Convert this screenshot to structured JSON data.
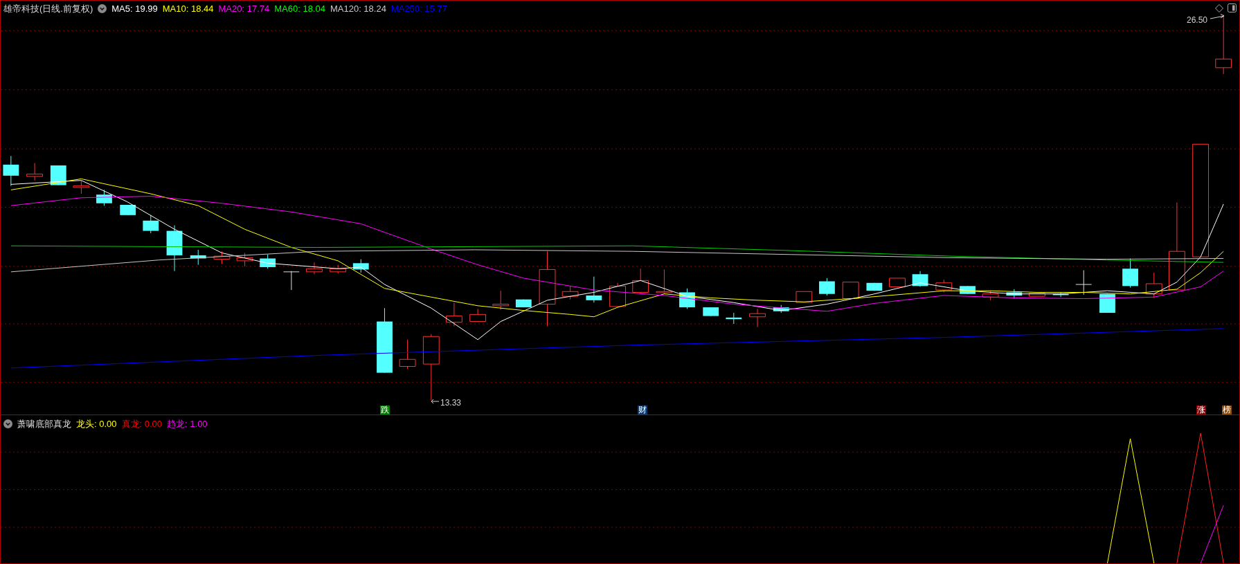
{
  "header": {
    "title": "雄帝科技(日线.前复权)",
    "ma_items": [
      {
        "label": "MA5: 19.99",
        "color": "#ffffff"
      },
      {
        "label": "MA10: 18.44",
        "color": "#ffff00"
      },
      {
        "label": "MA20: 17.74",
        "color": "#ff00ff"
      },
      {
        "label": "MA60: 18.04",
        "color": "#00ff00"
      },
      {
        "label": "MA120: 18.24",
        "color": "#c8c8c8"
      },
      {
        "label": "MA250: 15.77",
        "color": "#0000ff"
      }
    ]
  },
  "price_labels": {
    "high": "26.50",
    "low": "13.33"
  },
  "markers": [
    {
      "text": "跌",
      "color": "#007a00"
    },
    {
      "text": "财",
      "color": "#0a3a6e"
    },
    {
      "text": "涨",
      "color": "#8b0000"
    },
    {
      "text": "榜",
      "color": "#8b4a0a"
    }
  ],
  "indicator": {
    "title": "萧啸底部真龙",
    "items": [
      {
        "label": "龙头: 0.00",
        "color": "#ffff00"
      },
      {
        "label": "真龙: 0.00",
        "color": "#ff0000"
      },
      {
        "label": "趋龙: 1.00",
        "color": "#ff00ff"
      }
    ]
  }
}
